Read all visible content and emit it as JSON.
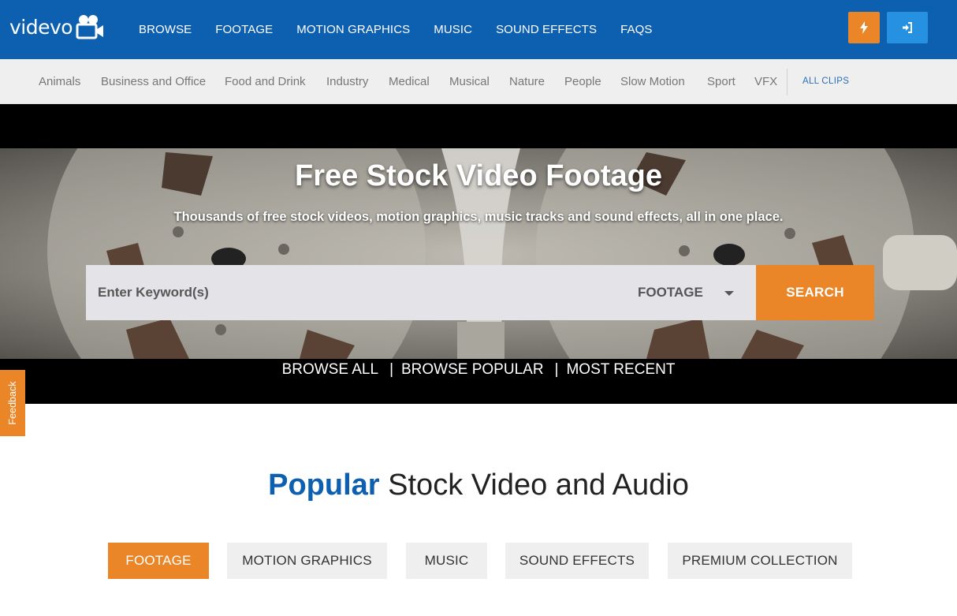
{
  "brand": {
    "name": "videvo"
  },
  "topnav": {
    "items": [
      "BROWSE",
      "FOOTAGE",
      "MOTION GRAPHICS",
      "MUSIC",
      "SOUND EFFECTS",
      "FAQS"
    ]
  },
  "categories": {
    "items": [
      "Animals",
      "Business and Office",
      "Food and Drink",
      "Industry",
      "Medical",
      "Musical",
      "Nature",
      "People",
      "Slow Motion",
      "Sport",
      "VFX"
    ],
    "all_clips": "ALL CLIPS"
  },
  "hero": {
    "title": "Free Stock Video Footage",
    "subtitle": "Thousands of free stock videos, motion graphics, music tracks and sound effects, all in one place."
  },
  "search": {
    "placeholder": "Enter Keyword(s)",
    "selected_type": "FOOTAGE",
    "button_label": "SEARCH"
  },
  "browse_links": {
    "all": "BROWSE ALL",
    "popular": "BROWSE POPULAR",
    "recent": "MOST RECENT",
    "separator": "|"
  },
  "feedback": {
    "label": "Feedback"
  },
  "popular": {
    "title_accent": "Popular",
    "title_rest": "Stock Video and Audio",
    "tabs": [
      "FOOTAGE",
      "MOTION GRAPHICS",
      "MUSIC",
      "SOUND EFFECTS",
      "PREMIUM COLLECTION"
    ],
    "active_tab": "FOOTAGE"
  },
  "colors": {
    "brand_blue": "#0d5fb0",
    "accent_orange": "#ea8628",
    "login_blue": "#2591e0"
  },
  "icons": {
    "logo": "video-camera-icon",
    "bolt": "lightning-icon",
    "login": "sign-in-icon",
    "dropdown": "caret-down-icon"
  }
}
